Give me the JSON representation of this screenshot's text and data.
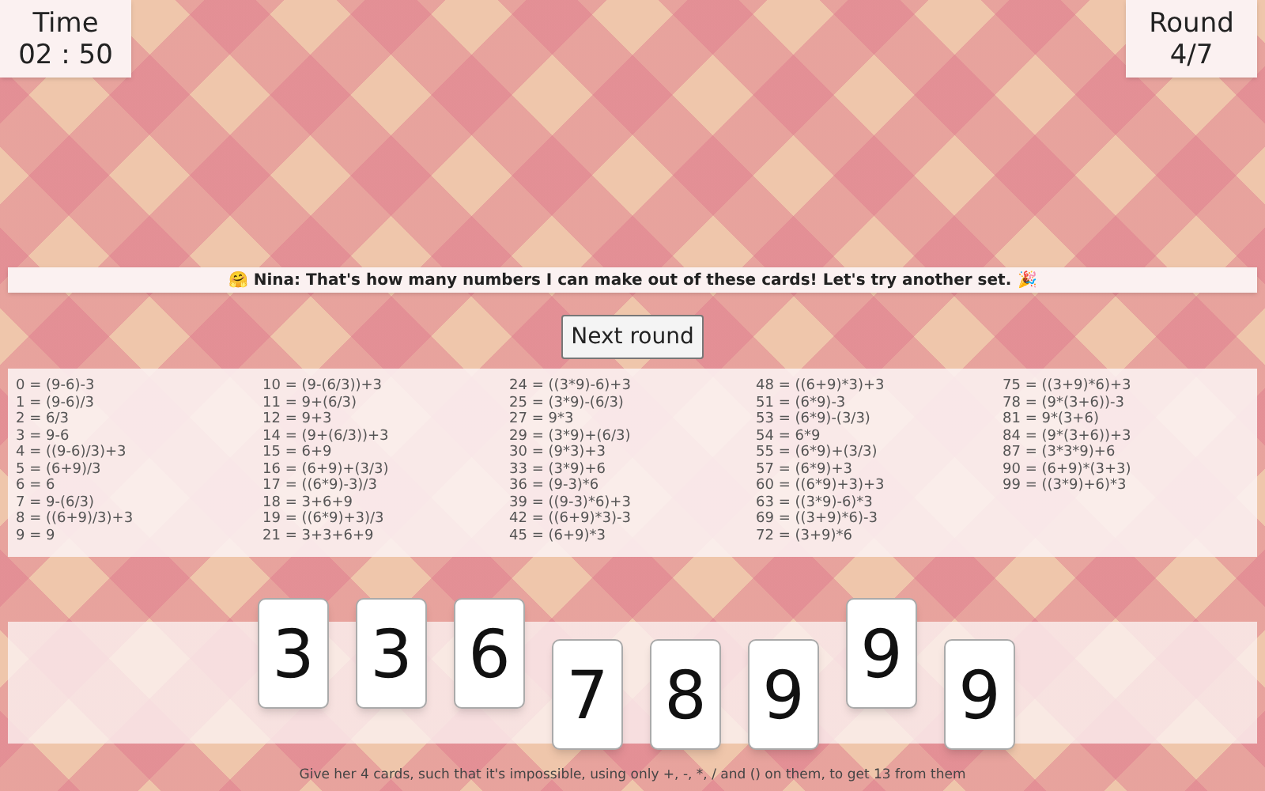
{
  "timer": {
    "label": "Time",
    "value": "02 : 50"
  },
  "round": {
    "label": "Round",
    "value": "4/7"
  },
  "message": {
    "icon": "🤗",
    "text": "Nina: That's how many numbers I can make out of these cards! Let's try another set.",
    "end_icon": "🎉"
  },
  "next_button": "Next round",
  "solutions": [
    [
      "0 = (9-6)-3",
      "1 = (9-6)/3",
      "2 = 6/3",
      "3 = 9-6",
      "4 = ((9-6)/3)+3",
      "5 = (6+9)/3",
      "6 = 6",
      "7 = 9-(6/3)",
      "8 = ((6+9)/3)+3",
      "9 = 9"
    ],
    [
      "10 = (9-(6/3))+3",
      "11 = 9+(6/3)",
      "12 = 9+3",
      "14 = (9+(6/3))+3",
      "15 = 6+9",
      "16 = (6+9)+(3/3)",
      "17 = ((6*9)-3)/3",
      "18 = 3+6+9",
      "19 = ((6*9)+3)/3",
      "21 = 3+3+6+9"
    ],
    [
      "24 = ((3*9)-6)+3",
      "25 = (3*9)-(6/3)",
      "27 = 9*3",
      "29 = (3*9)+(6/3)",
      "30 = (9*3)+3",
      "33 = (3*9)+6",
      "36 = (9-3)*6",
      "39 = ((9-3)*6)+3",
      "42 = ((6+9)*3)-3",
      "45 = (6+9)*3"
    ],
    [
      "48 = ((6+9)*3)+3",
      "51 = (6*9)-3",
      "53 = (6*9)-(3/3)",
      "54 = 6*9",
      "55 = (6*9)+(3/3)",
      "57 = (6*9)+3",
      "60 = ((6*9)+3)+3",
      "63 = ((3*9)-6)*3",
      "69 = ((3+9)*6)-3",
      "72 = (3+9)*6"
    ],
    [
      "75 = ((3+9)*6)+3",
      "78 = (9*(3+6))-3",
      "81 = 9*(3+6)",
      "84 = (9*(3+6))+3",
      "87 = (3*3*9)+6",
      "90 = (6+9)*(3+3)",
      "99 = ((3*9)+6)*3"
    ]
  ],
  "cards": [
    {
      "value": "3",
      "raised": true
    },
    {
      "value": "3",
      "raised": true
    },
    {
      "value": "6",
      "raised": true
    },
    {
      "value": "7",
      "raised": false
    },
    {
      "value": "8",
      "raised": false
    },
    {
      "value": "9",
      "raised": false
    },
    {
      "value": "9",
      "raised": true
    },
    {
      "value": "9",
      "raised": false
    }
  ],
  "instruction": "Give her 4 cards, such that it's impossible, using only +, -, *, / and () on them, to get 13 from them"
}
